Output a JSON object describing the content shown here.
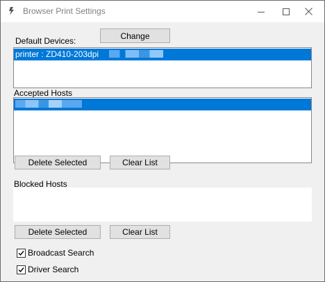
{
  "window": {
    "title": "Browser Print Settings",
    "controls": [
      "minimize-icon",
      "maximize-icon",
      "close-icon"
    ]
  },
  "default_devices": {
    "label": "Default Devices:",
    "change_label": "Change",
    "items": [
      "printer : ZD410-203dpi"
    ]
  },
  "accepted_hosts": {
    "label": "Accepted Hosts",
    "delete_label": "Delete Selected",
    "clear_label": "Clear List"
  },
  "blocked_hosts": {
    "label": "Blocked Hosts",
    "delete_label": "Delete Selected",
    "clear_label": "Clear List"
  },
  "options": {
    "broadcast_search": {
      "label": "Broadcast Search",
      "checked": true
    },
    "driver_search": {
      "label": "Driver Search",
      "checked": true
    }
  },
  "colors": {
    "selection": "#0078d7",
    "window_bg": "#f0f0f0"
  }
}
